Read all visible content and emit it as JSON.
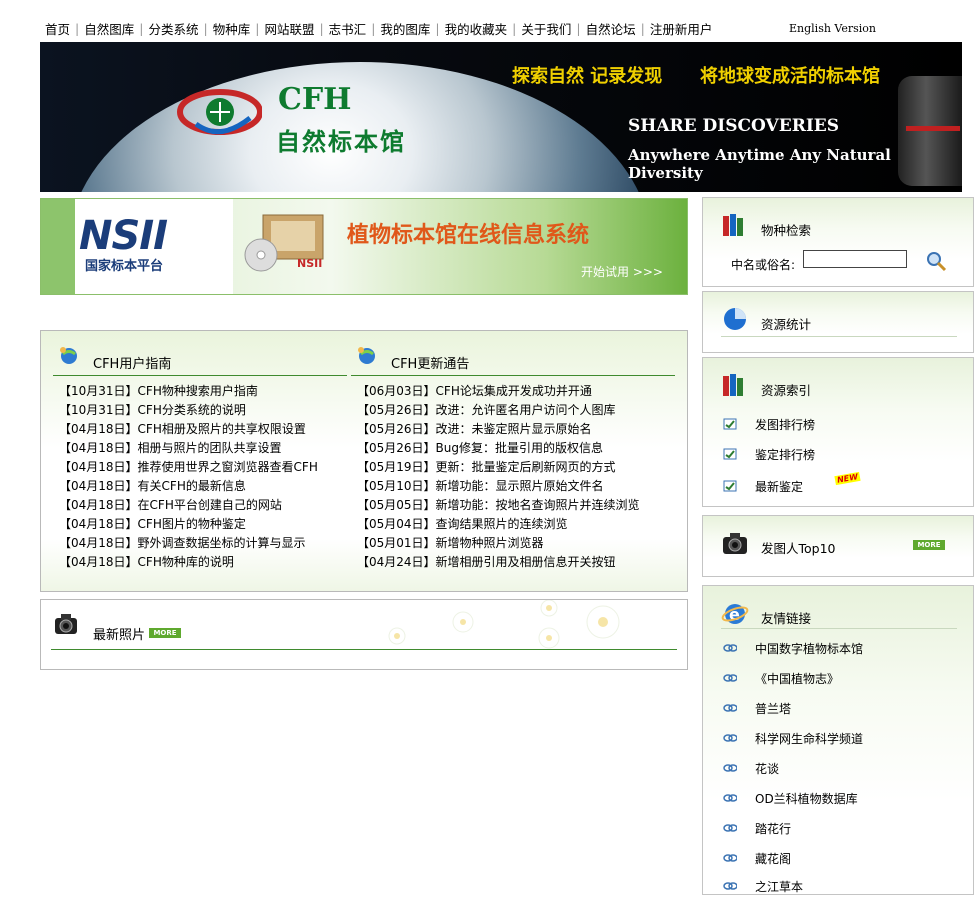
{
  "nav": {
    "items": [
      "首页",
      "自然图库",
      "分类系统",
      "物种库",
      "网站联盟",
      "志书汇",
      "我的图库",
      "我的收藏夹",
      "关于我们",
      "自然论坛",
      "注册新用户"
    ],
    "english": "English Version"
  },
  "banner": {
    "cfh": "CFH",
    "title": "自然标本馆",
    "slogan1": "探索自然 记录发现",
    "slogan2": "将地球变成活的标本馆",
    "share": "SHARE DISCOVERIES",
    "anywhere": "Anywhere Anytime Any Natural Diversity"
  },
  "nsii": {
    "logo": "NSII",
    "logo_sub": "国家标本平台",
    "title": "植物标本馆在线信息系统",
    "trial": "开始试用 >>>"
  },
  "guide": {
    "title": "CFH用户指南",
    "items": [
      {
        "date": "【10月31日】",
        "text": "CFH物种搜索用户指南"
      },
      {
        "date": "【10月31日】",
        "text": "CFH分类系统的说明"
      },
      {
        "date": "【04月18日】",
        "text": "CFH相册及照片的共享权限设置"
      },
      {
        "date": "【04月18日】",
        "text": "相册与照片的团队共享设置"
      },
      {
        "date": "【04月18日】",
        "text": "推荐使用世界之窗浏览器查看CFH"
      },
      {
        "date": "【04月18日】",
        "text": "有关CFH的最新信息"
      },
      {
        "date": "【04月18日】",
        "text": "在CFH平台创建自己的网站"
      },
      {
        "date": "【04月18日】",
        "text": "CFH图片的物种鉴定"
      },
      {
        "date": "【04月18日】",
        "text": "野外调查数据坐标的计算与显示"
      },
      {
        "date": "【04月18日】",
        "text": "CFH物种库的说明"
      }
    ]
  },
  "updates": {
    "title": "CFH更新通告",
    "items": [
      {
        "date": "【06月03日】",
        "text": "CFH论坛集成开发成功并开通"
      },
      {
        "date": "【05月26日】",
        "text": "改进：允许匿名用户访问个人图库"
      },
      {
        "date": "【05月26日】",
        "text": "改进：未鉴定照片显示原始名"
      },
      {
        "date": "【05月26日】",
        "text": "Bug修复：批量引用的版权信息"
      },
      {
        "date": "【05月19日】",
        "text": "更新：批量鉴定后刷新网页的方式"
      },
      {
        "date": "【05月10日】",
        "text": "新增功能：显示照片原始文件名"
      },
      {
        "date": "【05月05日】",
        "text": "新增功能：按地名查询照片并连续浏览"
      },
      {
        "date": "【05月04日】",
        "text": "查询结果照片的连续浏览"
      },
      {
        "date": "【05月01日】",
        "text": "新增物种照片浏览器"
      },
      {
        "date": "【04月24日】",
        "text": "新增相册引用及相册信息开关按钮"
      }
    ]
  },
  "photos": {
    "title": "最新照片",
    "more": "MORE"
  },
  "sidebar": {
    "search_title": "物种检索",
    "search_label": "中名或俗名:",
    "search_value": "",
    "stats_title": "资源统计",
    "index_title": "资源索引",
    "index_items": [
      "发图排行榜",
      "鉴定排行榜",
      "最新鉴定"
    ],
    "new_badge": "NEW",
    "top10_title": "发图人Top10",
    "top10_more": "MORE",
    "links_title": "友情链接",
    "links": [
      "中国数字植物标本馆",
      "《中国植物志》",
      "普兰塔",
      "科学网生命科学频道",
      "花谈",
      "OD兰科植物数据库",
      "踏花行",
      "藏花阁",
      "之江草本"
    ]
  },
  "colors": {
    "accent_green": "#3f8a2e",
    "banner_yellow": "#f0d000",
    "cfh_green": "#0e7b2f",
    "nsii_orange": "#e0581a"
  }
}
